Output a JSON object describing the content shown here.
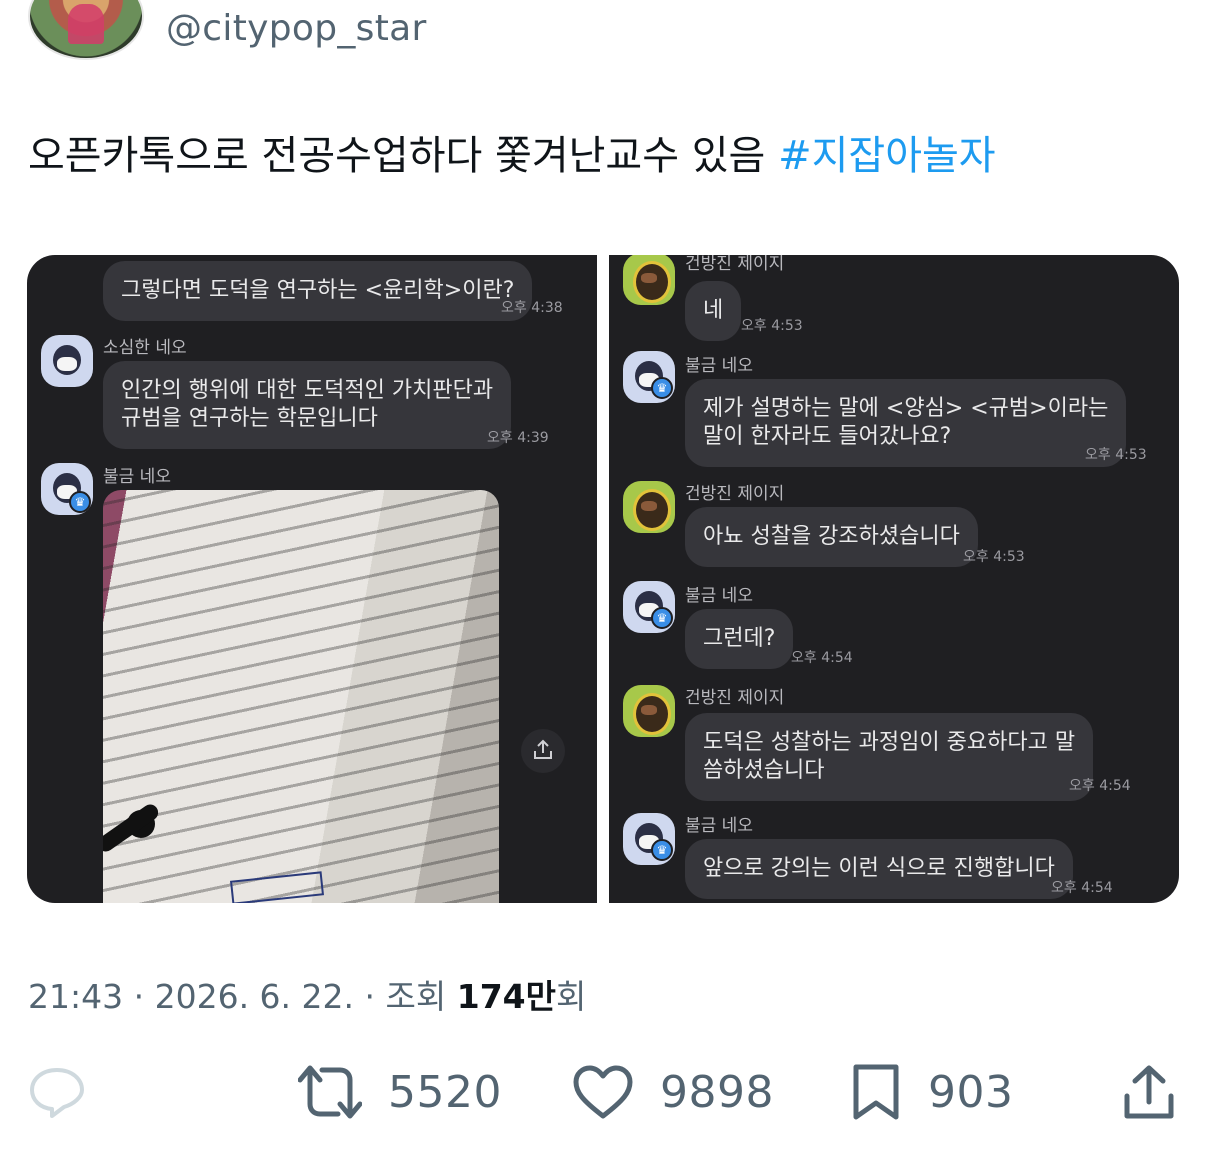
{
  "tweet": {
    "handle": "@citypop_star",
    "text": "오픈카톡으로 전공수업하다 쫓겨난교수 있음",
    "hashtag": "#지잡아놀자"
  },
  "chat_left": {
    "bubble1": {
      "text": "그렇다면 도덕을 연구하는 <윤리학>이란?",
      "time": "오후 4:38"
    },
    "msg2": {
      "sender": "소심한 네오",
      "line1": "인간의 행위에 대한 도덕적인 가치판단과",
      "line2": "규범을 연구하는 학문입니다",
      "time": "오후 4:39"
    },
    "msg3": {
      "sender": "불금 네오"
    }
  },
  "chat_right": {
    "msg1": {
      "sender": "건방진 제이지",
      "text": "네",
      "time": "오후 4:53"
    },
    "msg2": {
      "sender": "불금 네오",
      "line1": "제가 설명하는 말에 <양심> <규범>이라는",
      "line2": "말이 한자라도 들어갔나요?",
      "time": "오후 4:53"
    },
    "msg3": {
      "sender": "건방진 제이지",
      "text": "아뇨 성찰을 강조하셨습니다",
      "time": "오후 4:53"
    },
    "msg4": {
      "sender": "불금 네오",
      "text": "그런데?",
      "time": "오후 4:54"
    },
    "msg5": {
      "sender": "건방진 제이지",
      "line1": "도덕은 성찰하는 과정임이 중요하다고 말",
      "line2": "씀하셨습니다",
      "time": "오후 4:54"
    },
    "msg6": {
      "sender": "불금 네오",
      "text": "앞으로 강의는 이런 식으로 진행합니다",
      "time": "오후 4:54"
    }
  },
  "meta": {
    "time": "21:43",
    "date": "2026. 6. 22.",
    "views_label": "조회",
    "views_value": "174만",
    "views_suffix": "회"
  },
  "actions": {
    "reply_icon": "reply-icon",
    "retweet_icon": "retweet-icon",
    "retweets": "5520",
    "like_icon": "heart-icon",
    "likes": "9898",
    "bookmark_icon": "bookmark-icon",
    "bookmarks": "903",
    "share_icon": "share-icon"
  },
  "colors": {
    "hashtag": "#1d9bf0",
    "secondary_text": "#536471",
    "chat_background": "#1f1f22",
    "bubble": "#36363b"
  }
}
